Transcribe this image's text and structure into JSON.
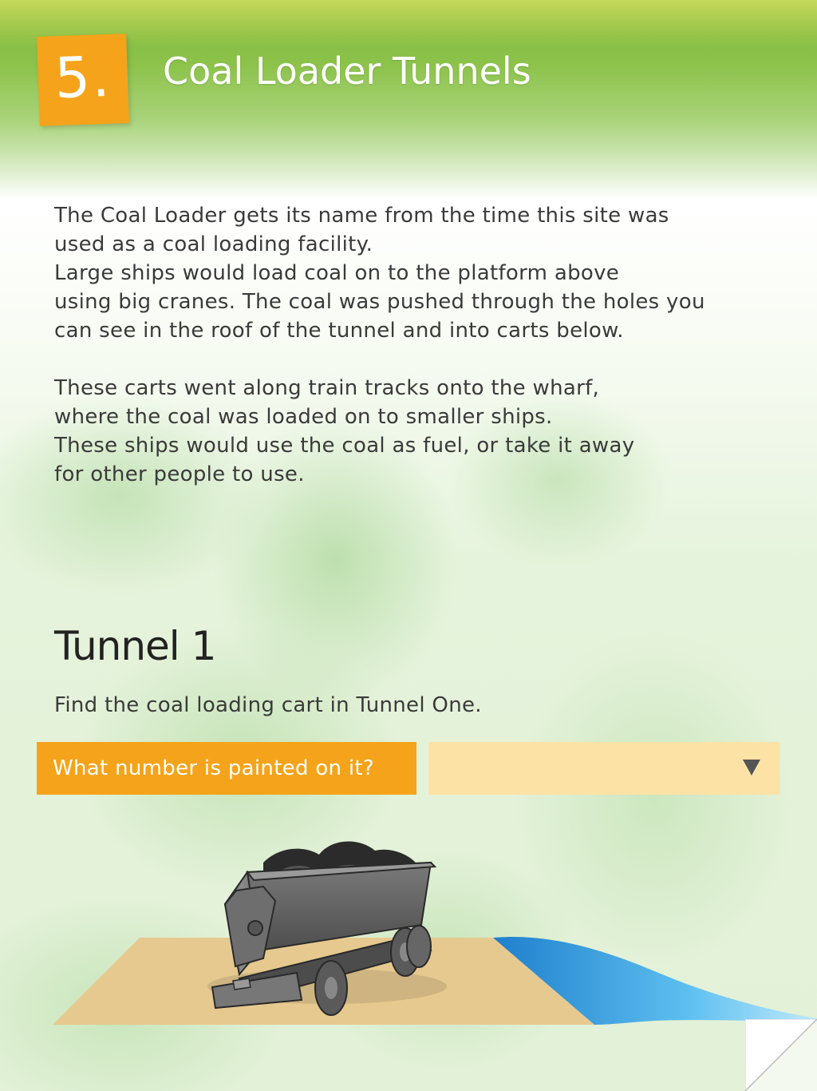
{
  "header": {
    "badge_number": "5.",
    "title": "Coal Loader Tunnels"
  },
  "intro": {
    "paragraph1_lines": [
      "The Coal Loader gets its name from the time this site was",
      "used as a coal loading facility.",
      "Large ships would load coal on to the platform above",
      "using big cranes. The coal was pushed through the holes you",
      "can see in the roof of the tunnel and into carts below."
    ],
    "paragraph2_lines": [
      "These carts went along train tracks onto the wharf,",
      "where the coal was loaded on to smaller ships.",
      "These ships would use the coal as fuel, or take it away",
      "for other people to use."
    ]
  },
  "section": {
    "heading": "Tunnel 1",
    "instruction": "Find the coal loading cart in Tunnel One."
  },
  "question": {
    "label": "What number is painted on it?",
    "selected_value": "",
    "arrow_icon": "triangle-down-icon"
  },
  "colors": {
    "accent_orange": "#f5a31a",
    "select_background": "#fde2a6",
    "header_green": "#7fb83c",
    "sand": "#e6c98f",
    "water": "#2f8fd6"
  },
  "illustration": {
    "subject": "coal-cart-icon"
  }
}
